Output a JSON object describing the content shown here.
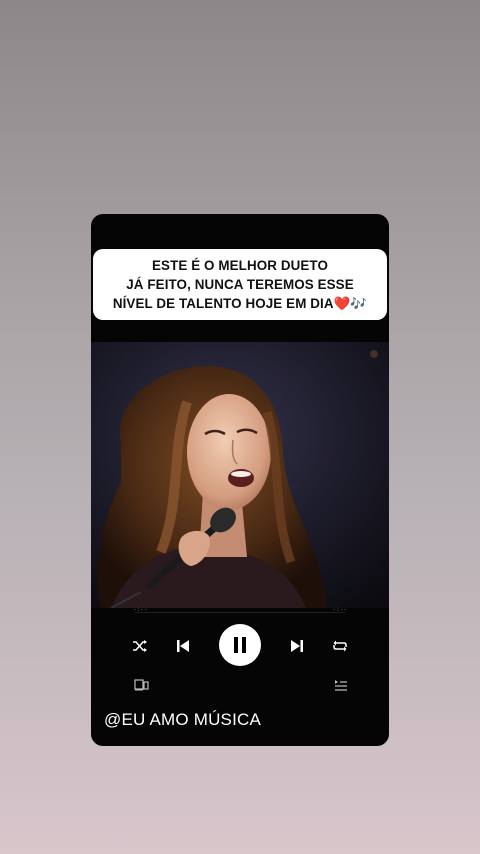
{
  "caption": {
    "line1": "ESTE É O MELHOR DUETO",
    "line2": "JÁ FEITO, NUNCA TEREMOS ESSE",
    "line3": "NÍVEL DE TALENTO HOJE EM DIA❤️🎶"
  },
  "player": {
    "elapsed": "-:--",
    "remaining": "-:--",
    "state": "playing",
    "controls": [
      "shuffle-icon",
      "previous-icon",
      "pause-icon",
      "next-icon",
      "repeat-icon"
    ],
    "bottom_left_icon": "connect-device-icon",
    "bottom_right_icon": "queue-icon"
  },
  "watermark": "@EU AMO MÚSICA",
  "colors": {
    "card": "#050505",
    "caption_bg": "#ffffff",
    "caption_text": "#111111",
    "icon": "#ffffff",
    "heart": "#e0202e"
  }
}
